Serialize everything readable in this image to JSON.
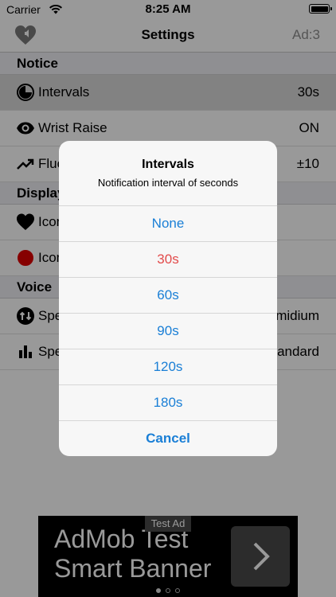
{
  "status_bar": {
    "carrier": "Carrier",
    "time": "8:25 AM"
  },
  "nav": {
    "title": "Settings",
    "ad_label": "Ad:3",
    "logo_icon": "heart-speaker-icon"
  },
  "sections": {
    "notice": "Notice",
    "display": "Display",
    "voice": "Voice"
  },
  "rows": {
    "intervals": {
      "label": "Intervals",
      "value": "30s",
      "icon": "clock-icon"
    },
    "wrist": {
      "label": "Wrist Raise",
      "value": "ON",
      "icon": "eye-icon"
    },
    "fluc": {
      "label": "Fluc",
      "value": "±10",
      "icon": "trend-up-icon"
    },
    "icon1": {
      "label": "Icon",
      "value": "",
      "icon": "heart-icon"
    },
    "icon2": {
      "label": "Icon",
      "value": "",
      "icon": "red-dot-icon"
    },
    "speed": {
      "label": "Spe",
      "value": "midium",
      "icon": "speed-arrows-icon"
    },
    "speaker": {
      "label": "Spe",
      "value": "andard",
      "icon": "bar-chart-icon"
    }
  },
  "dialog": {
    "title": "Intervals",
    "message": "Notification interval of seconds",
    "options": [
      "None",
      "30s",
      "60s",
      "90s",
      "120s",
      "180s"
    ],
    "selected": "30s",
    "cancel": "Cancel"
  },
  "ad": {
    "tag": "Test Ad",
    "line1": "AdMob Test",
    "line2": "Smart Banner"
  },
  "colors": {
    "accent": "#1a7fd6",
    "selected_option": "#e24b4b",
    "section_bg": "#efeff4"
  }
}
